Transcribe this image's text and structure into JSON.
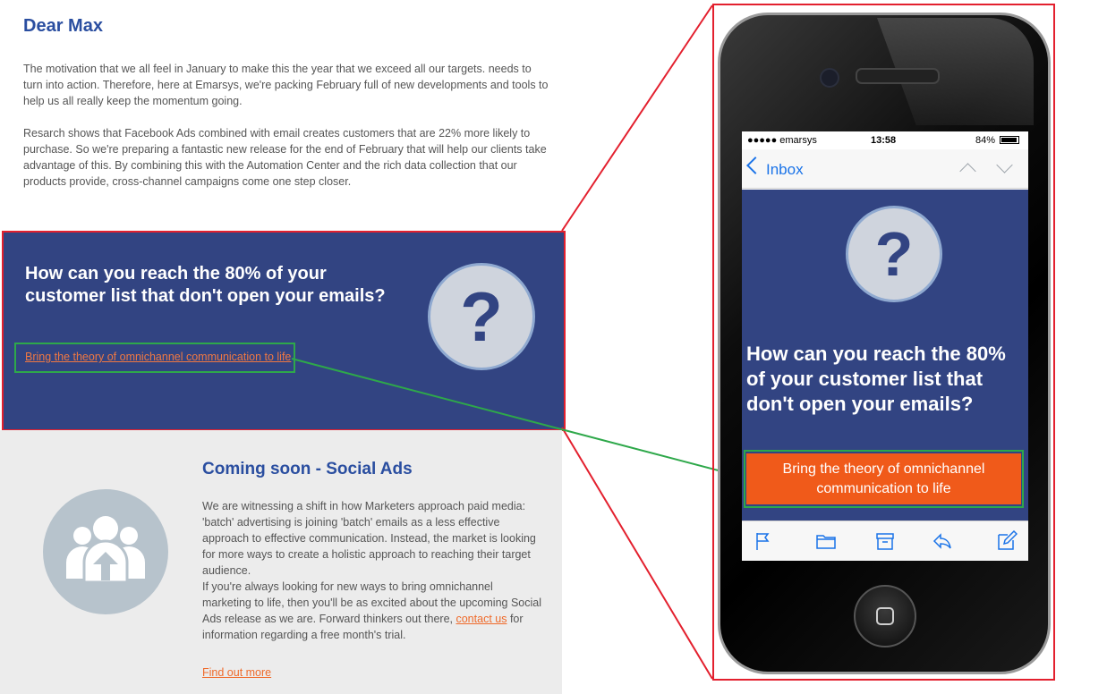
{
  "email": {
    "greeting": "Dear Max",
    "paragraph1": "The motivation that we all feel in January to make this the year that we exceed all our targets. needs to turn into action. Therefore, here at Emarsys, we're packing February full of new developments and tools to help us all really keep the momentum going.",
    "paragraph2": "Resarch shows that Facebook Ads combined with email creates customers that are 22% more likely to purchase. So we're preparing a fantastic new release for the end of February that will help our clients take advantage of this. By combining this with the Automation Center and the rich data collection that our products provide, cross-channel campaigns come one step closer.",
    "hero": {
      "title": "How can you reach the 80% of your customer list that don't open your emails?",
      "question_mark": "?",
      "link": "Bring the theory of omnichannel communication to life"
    },
    "social": {
      "title": "Coming soon - Social Ads",
      "text_part1": "We are witnessing a shift in how Marketers approach paid media: 'batch' advertising is joining 'batch' emails as a less effective approach to effective communication. Instead, the market is looking for more ways to create a holistic approach to reaching their target audience.",
      "text_part2": "If you're always looking for new ways to bring omnichannel marketing to life, then you'll be as excited about the upcoming Social Ads release as we are. Forward thinkers out there,",
      "contact_link": "contact us",
      "text_part3": "for information regarding a free month's trial.",
      "find_out_more": "Find out more"
    }
  },
  "phone": {
    "status": {
      "carrier": "●●●●● emarsys",
      "time": "13:58",
      "battery": "84%"
    },
    "nav": {
      "back_label": "Inbox"
    },
    "mail": {
      "question_mark": "?",
      "title": "How can you reach the 80% of your customer list that don't open your emails?",
      "cta": "Bring the theory of omnichannel communication to life"
    },
    "toolbar_icons": [
      "flag-icon",
      "folder-icon",
      "archive-icon",
      "reply-icon",
      "compose-icon"
    ]
  },
  "colors": {
    "brand_blue": "#2a4ea0",
    "hero_bg": "#324482",
    "cta_orange": "#f05a1a",
    "link_orange": "#ef6a2a",
    "highlight_red": "#e3202e",
    "highlight_green": "#2ea84a"
  }
}
